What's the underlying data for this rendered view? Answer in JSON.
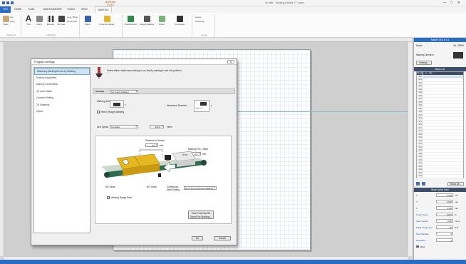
{
  "window": {
    "title": "Un-title - Marking Builder 3 / Laser...",
    "context_tab_title": "MARKING TOOLS",
    "minimize": "—",
    "maximize": "□",
    "close": "✕"
  },
  "tabs": [
    {
      "label": "FILE"
    },
    {
      "label": "HOME"
    },
    {
      "label": "DATA"
    },
    {
      "label": "LASER MARKER"
    },
    {
      "label": "TOOLS"
    },
    {
      "label": "VIEW"
    },
    {
      "label": "MARKING"
    }
  ],
  "ribbon": {
    "groups": [
      "Clipboard",
      "Add Block",
      "",
      "Layout"
    ],
    "buttons": [
      "Paste",
      "Cut",
      "Copy",
      "Text",
      "String",
      "Barcode",
      "2D Code",
      "Logo, Photo",
      "Fixed Point",
      "Matrix",
      "Program settings",
      "Transfer/Load",
      "Sample Marking",
      "Printer",
      "Connection",
      "Layout",
      "Centering"
    ]
  },
  "colors": {
    "accent": "#2b6cc4",
    "yellow": "#e6b820",
    "green": "#2f6b4e",
    "panel_dark": "#3b4d68"
  },
  "dialog": {
    "title": "Program settings",
    "close": "✕",
    "nav": [
      "Stationary Marking/On-the-fly Marking",
      "Position Adjustment",
      "Marking Confirmation",
      "2D code reader",
      "Common Setting",
      "2D Snapshot",
      "Option"
    ],
    "hint": "Select either stationary marking or on-the-fly marking to set this position.",
    "settings_label": "Settings",
    "settings_value": "On-the-fly Marking",
    "marking_label": "Marking direction",
    "mirror_label": "Mirror (Image) Marking",
    "movement_label": "Movement Direction",
    "line_speed_label": "Line Speed",
    "line_speed_mode": "Constant",
    "line_speed_value": "300.0",
    "line_speed_unit": "mm/s",
    "distance_label": "Distance to Sensor",
    "distance_value": "0.0",
    "distance_unit": "mm",
    "offset_label": "Marking Pos. Offset",
    "offset_value": "0.0",
    "offset_unit": "mm",
    "ng_label_1": "NG Seam",
    "ng_label_2": "NG Seam",
    "continuous_label": "Continuous Mark Setting",
    "continuous_value": "Don't Do Continuous Marking",
    "range_label": "Marking Range Data",
    "time_button": "Time That Can Be Spent For Marking...",
    "ok": "OK",
    "cancel": "Cancel",
    "product_text": "Auto!"
  },
  "right_panel": {
    "header": "Marker 3x/4 X 4:1",
    "model_label": "Model",
    "model_value": "ML-Z9550",
    "marking_direction": "Marking Direction",
    "settings_button": "Settings...",
    "block_list_header": "Block List",
    "block_cols": [
      "Block",
      "A",
      "Abc"
    ],
    "block_rows": [
      "000",
      "001",
      "002",
      "003",
      "004",
      "005",
      "006",
      "007",
      "008",
      "009",
      "010",
      "011",
      "012",
      "013",
      "014",
      "015",
      "016",
      "017",
      "018",
      "019",
      "020",
      "021",
      "022",
      "023",
      "024",
      "025",
      "026",
      "027",
      "028",
      "029",
      "030",
      "031"
    ],
    "block_all_button": "Block All...",
    "quickview_header": "Block Quick View",
    "quickview": [
      {
        "label": "X",
        "value": "0.000",
        "unit": "mm"
      },
      {
        "label": "Y",
        "value": "0.000",
        "unit": "mm"
      },
      {
        "label": "Z",
        "value": "0.000",
        "unit": "mm"
      },
      {
        "label": "Laser Power",
        "value": "100.0",
        "unit": "%"
      },
      {
        "label": "Scan Speed",
        "value": "1000",
        "unit": "mm/s"
      },
      {
        "label": "Pulse Frequency",
        "value": "40",
        "unit": "kHz"
      },
      {
        "label": "Spot Variable",
        "value": "0",
        "unit": ""
      },
      {
        "label": "Repetition",
        "value": "1",
        "unit": ""
      }
    ],
    "mark_checkbox": "Mark"
  }
}
